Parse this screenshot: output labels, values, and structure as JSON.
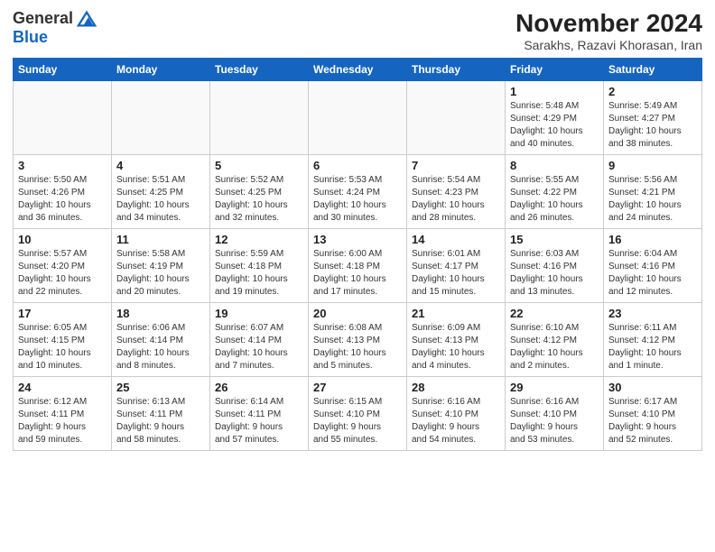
{
  "header": {
    "logo_general": "General",
    "logo_blue": "Blue",
    "title": "November 2024",
    "subtitle": "Sarakhs, Razavi Khorasan, Iran"
  },
  "weekdays": [
    "Sunday",
    "Monday",
    "Tuesday",
    "Wednesday",
    "Thursday",
    "Friday",
    "Saturday"
  ],
  "weeks": [
    [
      {
        "day": "",
        "info": ""
      },
      {
        "day": "",
        "info": ""
      },
      {
        "day": "",
        "info": ""
      },
      {
        "day": "",
        "info": ""
      },
      {
        "day": "",
        "info": ""
      },
      {
        "day": "1",
        "info": "Sunrise: 5:48 AM\nSunset: 4:29 PM\nDaylight: 10 hours\nand 40 minutes."
      },
      {
        "day": "2",
        "info": "Sunrise: 5:49 AM\nSunset: 4:27 PM\nDaylight: 10 hours\nand 38 minutes."
      }
    ],
    [
      {
        "day": "3",
        "info": "Sunrise: 5:50 AM\nSunset: 4:26 PM\nDaylight: 10 hours\nand 36 minutes."
      },
      {
        "day": "4",
        "info": "Sunrise: 5:51 AM\nSunset: 4:25 PM\nDaylight: 10 hours\nand 34 minutes."
      },
      {
        "day": "5",
        "info": "Sunrise: 5:52 AM\nSunset: 4:25 PM\nDaylight: 10 hours\nand 32 minutes."
      },
      {
        "day": "6",
        "info": "Sunrise: 5:53 AM\nSunset: 4:24 PM\nDaylight: 10 hours\nand 30 minutes."
      },
      {
        "day": "7",
        "info": "Sunrise: 5:54 AM\nSunset: 4:23 PM\nDaylight: 10 hours\nand 28 minutes."
      },
      {
        "day": "8",
        "info": "Sunrise: 5:55 AM\nSunset: 4:22 PM\nDaylight: 10 hours\nand 26 minutes."
      },
      {
        "day": "9",
        "info": "Sunrise: 5:56 AM\nSunset: 4:21 PM\nDaylight: 10 hours\nand 24 minutes."
      }
    ],
    [
      {
        "day": "10",
        "info": "Sunrise: 5:57 AM\nSunset: 4:20 PM\nDaylight: 10 hours\nand 22 minutes."
      },
      {
        "day": "11",
        "info": "Sunrise: 5:58 AM\nSunset: 4:19 PM\nDaylight: 10 hours\nand 20 minutes."
      },
      {
        "day": "12",
        "info": "Sunrise: 5:59 AM\nSunset: 4:18 PM\nDaylight: 10 hours\nand 19 minutes."
      },
      {
        "day": "13",
        "info": "Sunrise: 6:00 AM\nSunset: 4:18 PM\nDaylight: 10 hours\nand 17 minutes."
      },
      {
        "day": "14",
        "info": "Sunrise: 6:01 AM\nSunset: 4:17 PM\nDaylight: 10 hours\nand 15 minutes."
      },
      {
        "day": "15",
        "info": "Sunrise: 6:03 AM\nSunset: 4:16 PM\nDaylight: 10 hours\nand 13 minutes."
      },
      {
        "day": "16",
        "info": "Sunrise: 6:04 AM\nSunset: 4:16 PM\nDaylight: 10 hours\nand 12 minutes."
      }
    ],
    [
      {
        "day": "17",
        "info": "Sunrise: 6:05 AM\nSunset: 4:15 PM\nDaylight: 10 hours\nand 10 minutes."
      },
      {
        "day": "18",
        "info": "Sunrise: 6:06 AM\nSunset: 4:14 PM\nDaylight: 10 hours\nand 8 minutes."
      },
      {
        "day": "19",
        "info": "Sunrise: 6:07 AM\nSunset: 4:14 PM\nDaylight: 10 hours\nand 7 minutes."
      },
      {
        "day": "20",
        "info": "Sunrise: 6:08 AM\nSunset: 4:13 PM\nDaylight: 10 hours\nand 5 minutes."
      },
      {
        "day": "21",
        "info": "Sunrise: 6:09 AM\nSunset: 4:13 PM\nDaylight: 10 hours\nand 4 minutes."
      },
      {
        "day": "22",
        "info": "Sunrise: 6:10 AM\nSunset: 4:12 PM\nDaylight: 10 hours\nand 2 minutes."
      },
      {
        "day": "23",
        "info": "Sunrise: 6:11 AM\nSunset: 4:12 PM\nDaylight: 10 hours\nand 1 minute."
      }
    ],
    [
      {
        "day": "24",
        "info": "Sunrise: 6:12 AM\nSunset: 4:11 PM\nDaylight: 9 hours\nand 59 minutes."
      },
      {
        "day": "25",
        "info": "Sunrise: 6:13 AM\nSunset: 4:11 PM\nDaylight: 9 hours\nand 58 minutes."
      },
      {
        "day": "26",
        "info": "Sunrise: 6:14 AM\nSunset: 4:11 PM\nDaylight: 9 hours\nand 57 minutes."
      },
      {
        "day": "27",
        "info": "Sunrise: 6:15 AM\nSunset: 4:10 PM\nDaylight: 9 hours\nand 55 minutes."
      },
      {
        "day": "28",
        "info": "Sunrise: 6:16 AM\nSunset: 4:10 PM\nDaylight: 9 hours\nand 54 minutes."
      },
      {
        "day": "29",
        "info": "Sunrise: 6:16 AM\nSunset: 4:10 PM\nDaylight: 9 hours\nand 53 minutes."
      },
      {
        "day": "30",
        "info": "Sunrise: 6:17 AM\nSunset: 4:10 PM\nDaylight: 9 hours\nand 52 minutes."
      }
    ]
  ]
}
